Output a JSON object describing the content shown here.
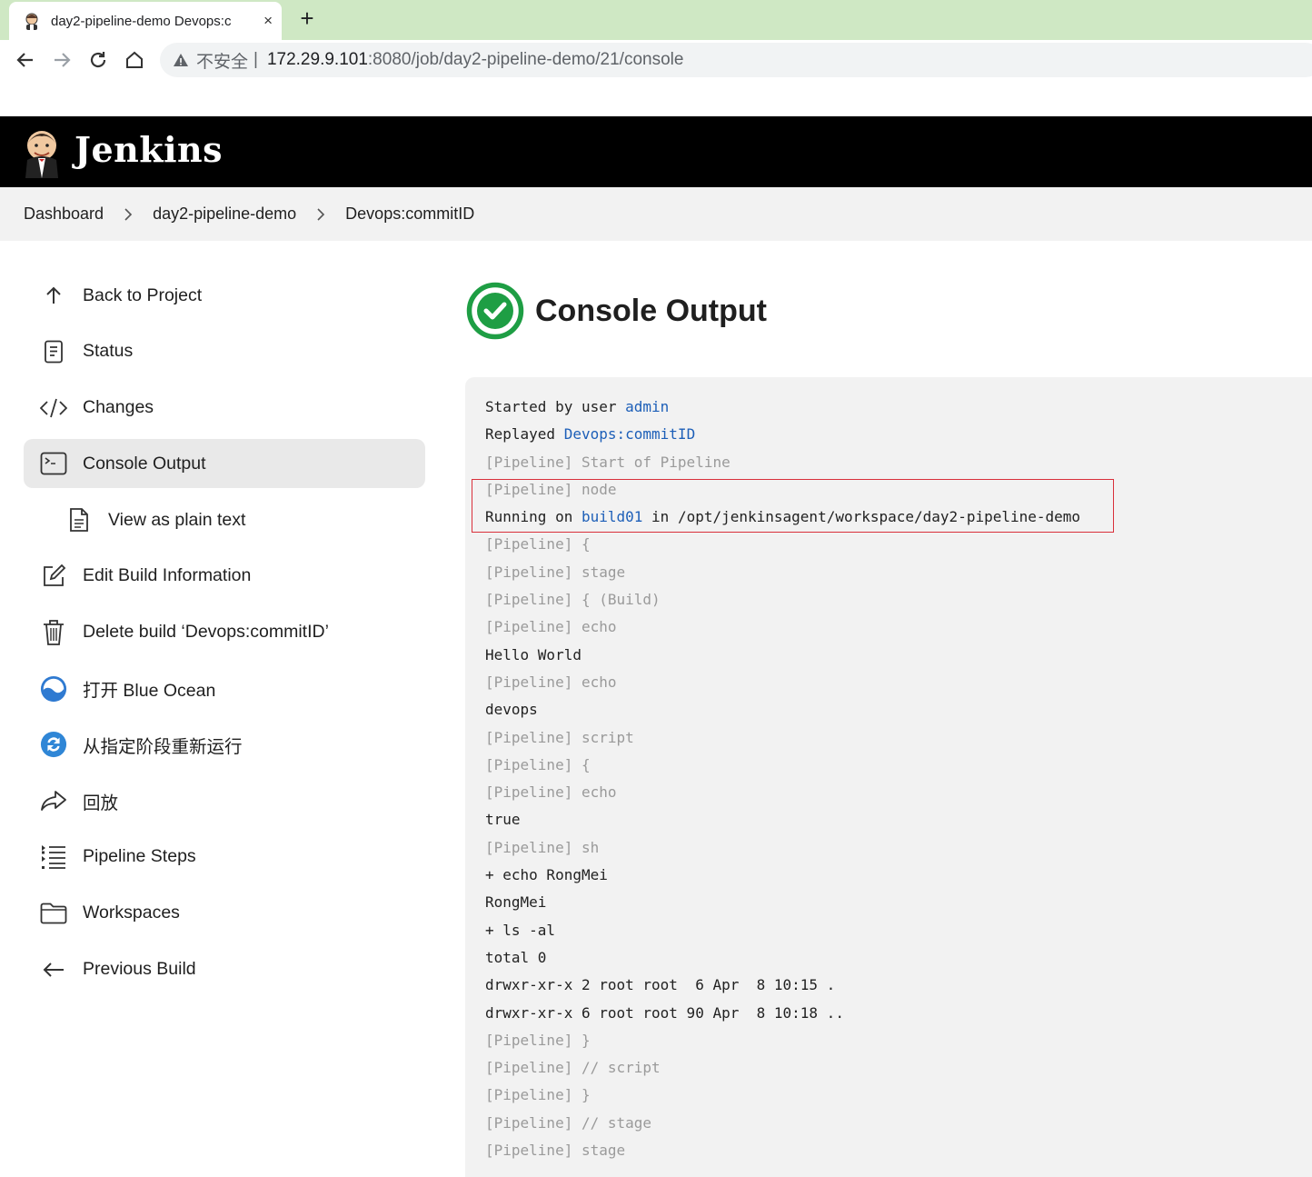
{
  "browser": {
    "tab_title": "day2-pipeline-demo Devops:c",
    "tab_close": "×",
    "new_tab": "+",
    "insecure_label": "不安全",
    "separator": "|",
    "url_host": "172.29.9.101",
    "url_path": ":8080/job/day2-pipeline-demo/21/console"
  },
  "header": {
    "brand": "Jenkins"
  },
  "breadcrumbs": [
    "Dashboard",
    "day2-pipeline-demo",
    "Devops:commitID"
  ],
  "sidebar": {
    "items": [
      {
        "label": "Back to Project",
        "icon": "arrow-up-icon"
      },
      {
        "label": "Status",
        "icon": "document-icon"
      },
      {
        "label": "Changes",
        "icon": "code-icon"
      },
      {
        "label": "Console Output",
        "icon": "terminal-icon",
        "active": true
      },
      {
        "label": "View as plain text",
        "icon": "file-text-icon",
        "sub": true
      },
      {
        "label": "Edit Build Information",
        "icon": "edit-icon"
      },
      {
        "label": "Delete build ‘Devops:commitID’",
        "icon": "trash-icon"
      },
      {
        "label": "打开 Blue Ocean",
        "icon": "blue-ocean-icon"
      },
      {
        "label": "从指定阶段重新运行",
        "icon": "restart-icon"
      },
      {
        "label": "回放",
        "icon": "replay-icon"
      },
      {
        "label": "Pipeline Steps",
        "icon": "list-icon"
      },
      {
        "label": "Workspaces",
        "icon": "folder-icon"
      },
      {
        "label": "Previous Build",
        "icon": "arrow-left-icon"
      }
    ]
  },
  "main": {
    "title": "Console Output",
    "status_icon": "success-check-icon",
    "status_color": "#1e9e44"
  },
  "console": {
    "lines": [
      {
        "text": "Started by user ",
        "link": "admin"
      },
      {
        "text": "Replayed ",
        "link": "Devops:commitID"
      },
      {
        "text": "[Pipeline] Start of Pipeline",
        "dim": true
      },
      {
        "text": "[Pipeline] node",
        "dim": true
      },
      {
        "text": "Running on ",
        "link": "build01",
        "after": " in /opt/jenkinsagent/workspace/day2-pipeline-demo"
      },
      {
        "text": "[Pipeline] {",
        "dim": true
      },
      {
        "text": "[Pipeline] stage",
        "dim": true
      },
      {
        "text": "[Pipeline] { (Build)",
        "dim": true
      },
      {
        "text": "[Pipeline] echo",
        "dim": true
      },
      {
        "text": "Hello World"
      },
      {
        "text": "[Pipeline] echo",
        "dim": true
      },
      {
        "text": "devops"
      },
      {
        "text": "[Pipeline] script",
        "dim": true
      },
      {
        "text": "[Pipeline] {",
        "dim": true
      },
      {
        "text": "[Pipeline] echo",
        "dim": true
      },
      {
        "text": "true"
      },
      {
        "text": "[Pipeline] sh",
        "dim": true
      },
      {
        "text": "+ echo RongMei"
      },
      {
        "text": "RongMei"
      },
      {
        "text": "+ ls -al"
      },
      {
        "text": "total 0"
      },
      {
        "text": "drwxr-xr-x 2 root root  6 Apr  8 10:15 ."
      },
      {
        "text": "drwxr-xr-x 6 root root 90 Apr  8 10:18 .."
      },
      {
        "text": "[Pipeline] }",
        "dim": true
      },
      {
        "text": "[Pipeline] // script",
        "dim": true
      },
      {
        "text": "[Pipeline] }",
        "dim": true
      },
      {
        "text": "[Pipeline] // stage",
        "dim": true
      },
      {
        "text": "[Pipeline] stage",
        "dim": true
      }
    ]
  }
}
